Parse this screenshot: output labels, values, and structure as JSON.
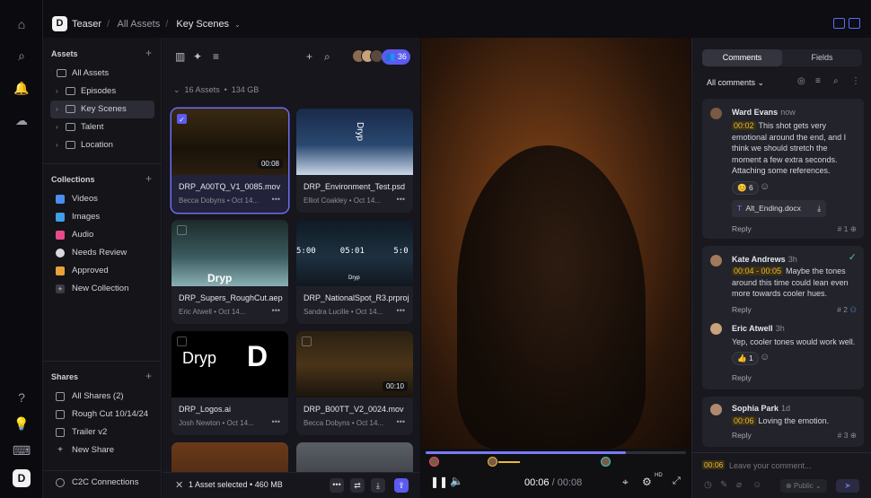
{
  "breadcrumbs": {
    "logo": "D",
    "project": "Teaser",
    "level1": "All Assets",
    "current": "Key Scenes"
  },
  "sidebar": {
    "assets_heading": "Assets",
    "assets": [
      {
        "label": "All Assets"
      },
      {
        "label": "Episodes"
      },
      {
        "label": "Key Scenes"
      },
      {
        "label": "Talent"
      },
      {
        "label": "Location"
      }
    ],
    "collections_heading": "Collections",
    "collections": [
      {
        "label": "Videos",
        "color": "#4a8ef0"
      },
      {
        "label": "Images",
        "color": "#3ea0e8"
      },
      {
        "label": "Audio",
        "color": "#e84a8a"
      },
      {
        "label": "Needs Review",
        "color": "#d9d9e0"
      },
      {
        "label": "Approved",
        "color": "#e8a23a"
      },
      {
        "label": "New Collection",
        "color": "#3a3a45"
      }
    ],
    "shares_heading": "Shares",
    "shares": [
      {
        "label": "All Shares (2)"
      },
      {
        "label": "Rough Cut 10/14/24"
      },
      {
        "label": "Trailer v2"
      },
      {
        "label": "New Share"
      }
    ],
    "c2c": "C2C Connections"
  },
  "grid": {
    "reviewer_count": "36",
    "asset_count": "16 Assets",
    "asset_size": "134 GB",
    "cards": [
      {
        "name": "DRP_A00TQ_V1_0085.mov",
        "user": "Becca Dobyns",
        "date": "Oct 14...",
        "duration": "00:08"
      },
      {
        "name": "DRP_Environment_Test.psd",
        "user": "Elliot Coakley",
        "date": "Oct 14...",
        "duration": ""
      },
      {
        "name": "DRP_Supers_RoughCut.aep",
        "user": "Eric Atwell",
        "date": "Oct 14...",
        "duration": ""
      },
      {
        "name": "DRP_NationalSpot_R3.prproj",
        "user": "Sandra Lucille",
        "date": "Oct 14...",
        "duration": ""
      },
      {
        "name": "DRP_Logos.ai",
        "user": "Josh Newton",
        "date": "Oct 14...",
        "duration": ""
      },
      {
        "name": "DRP_B00TT_V2_0024.mov",
        "user": "Becca Dobyns",
        "date": "Oct 14...",
        "duration": "00:10"
      }
    ],
    "thumb_text": {
      "bottle": "Dryp",
      "supers": "Dryp",
      "logo": "Dryp",
      "logo_mark": "D",
      "time_a": "5:00",
      "time_b": "05:01",
      "time_c": "5:0",
      "small": "Dryp"
    },
    "selection": "1 Asset selected",
    "selection_size": "460 MB"
  },
  "viewer": {
    "current_time": "00:06",
    "total_time": "00:08",
    "separator": "/",
    "quality": "HD",
    "progress": 0.77
  },
  "comments_panel": {
    "tab_comments": "Comments",
    "tab_fields": "Fields",
    "filter": "All comments",
    "comments": [
      {
        "name": "Ward Evans",
        "time": "now",
        "timecode": "00:02",
        "text": "This shot gets very emotional around the end, and I think we should stretch the moment a few extra seconds. Attaching some references.",
        "reaction": "6",
        "attachment": "Alt_Ending.docx",
        "reply": "Reply",
        "number": "# 1"
      },
      {
        "name": "Kate Andrews",
        "time": "3h",
        "timecode": "00:04 - 00:05",
        "text": "Maybe the tones around this time could lean even more towards cooler hues.",
        "reply": "Reply",
        "number": "# 2"
      },
      {
        "name": "Eric Atwell",
        "time": "3h",
        "timecode": "",
        "text": "Yep, cooler tones would work well.",
        "reaction": "1",
        "reply": "Reply",
        "number": ""
      },
      {
        "name": "Sophia Park",
        "time": "1d",
        "timecode": "00:06",
        "text": "Loving the emotion.",
        "reply": "Reply",
        "number": "# 3"
      }
    ],
    "composer_timecode": "00:06",
    "composer_placeholder": "Leave your comment...",
    "visibility": "Public"
  }
}
